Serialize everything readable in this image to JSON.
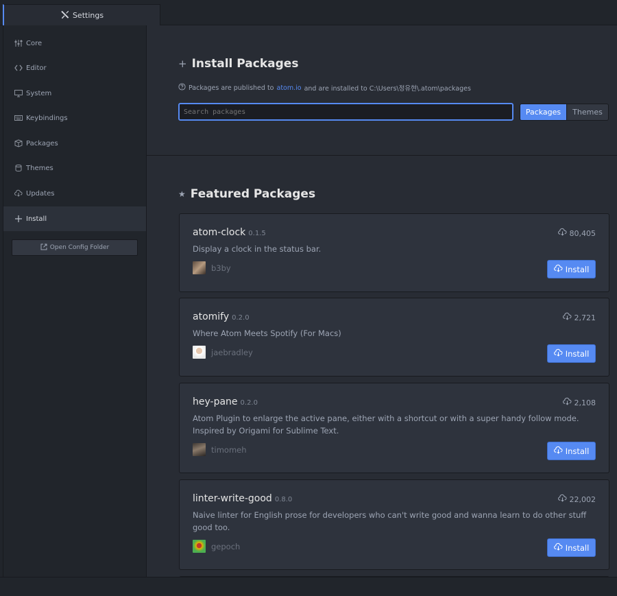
{
  "tab": {
    "title": "Settings",
    "icon": "tools-icon"
  },
  "sidebar": {
    "items": [
      {
        "label": "Core",
        "icon": "sliders-icon"
      },
      {
        "label": "Editor",
        "icon": "code-icon"
      },
      {
        "label": "System",
        "icon": "monitor-icon"
      },
      {
        "label": "Keybindings",
        "icon": "keyboard-icon"
      },
      {
        "label": "Packages",
        "icon": "package-icon"
      },
      {
        "label": "Themes",
        "icon": "paintcan-icon"
      },
      {
        "label": "Updates",
        "icon": "cloud-download-icon"
      },
      {
        "label": "Install",
        "icon": "plus-icon",
        "active": true
      }
    ],
    "open_config_label": "Open Config Folder"
  },
  "install": {
    "title": "Install Packages",
    "hint_prefix": "Packages are published to",
    "hint_link": "atom.io",
    "hint_suffix": "and are installed to C:\\Users\\정유현\\.atom\\packages",
    "search_placeholder": "Search packages",
    "search_value": "",
    "toggle_packages": "Packages",
    "toggle_themes": "Themes",
    "toggle_selected": "Packages"
  },
  "featured": {
    "title": "Featured Packages",
    "install_label": "Install",
    "packages": [
      {
        "name": "atom-clock",
        "version": "0.1.5",
        "downloads": "80,405",
        "description": "Display a clock in the status bar.",
        "author": "b3by"
      },
      {
        "name": "atomify",
        "version": "0.2.0",
        "downloads": "2,721",
        "description": "Where Atom Meets Spotify (For Macs)",
        "author": "jaebradley"
      },
      {
        "name": "hey-pane",
        "version": "0.2.0",
        "downloads": "2,108",
        "description": "Atom Plugin to enlarge the active pane, either with a shortcut or with a super handy follow mode. Inspired by Origami for Sublime Text.",
        "author": "timomeh"
      },
      {
        "name": "linter-write-good",
        "version": "0.8.0",
        "downloads": "22,002",
        "description": "Naive linter for English prose for developers who can't write good and wanna learn to do other stuff good too.",
        "author": "gepoch"
      }
    ]
  },
  "colors": {
    "accent": "#568af2",
    "background": "#282c34",
    "sidebar": "#21252b"
  }
}
